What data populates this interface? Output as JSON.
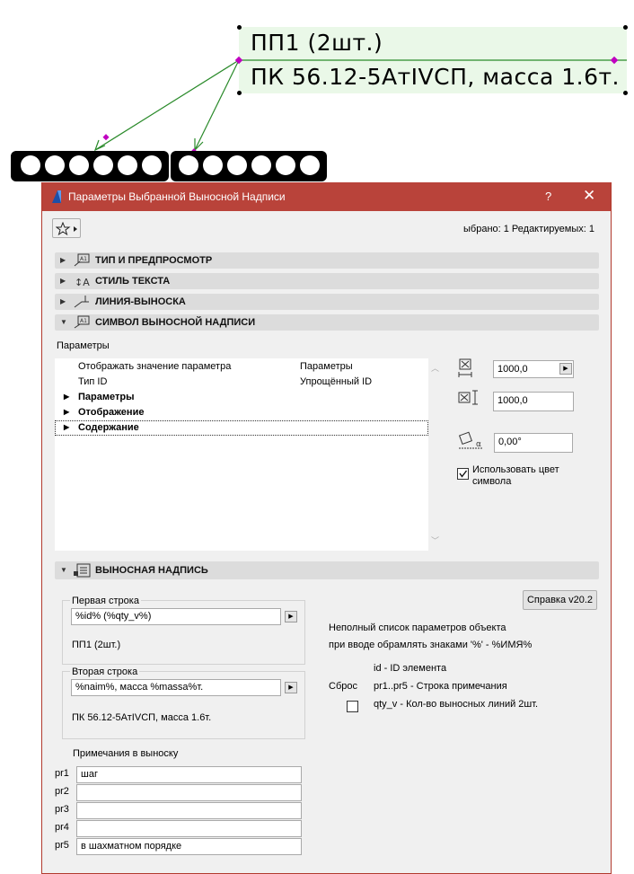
{
  "drawing": {
    "label_line1": "ПП1 (2шт.)",
    "label_line2": "ПК 56.12-5АтIVCП, масса 1.6т."
  },
  "dialog": {
    "title": "Параметры Выбранной Выносной Надписи",
    "help": "?",
    "close": "✕",
    "selected_info": "ыбрано: 1 Редактируемых: 1",
    "sections": {
      "type_preview": "ТИП И ПРЕДПРОСМОТР",
      "text_style": "СТИЛЬ ТЕКСТА",
      "leader_line": "ЛИНИЯ-ВЫНОСКА",
      "label_symbol": "СИМВОЛ ВЫНОСНОЙ НАДПИСИ",
      "label": "ВЫНОСНАЯ НАДПИСЬ"
    },
    "params_label": "Параметры",
    "tree": [
      {
        "name": "Отображать значение параметра",
        "value": "Параметры"
      },
      {
        "name": "Тип ID",
        "value": "Упрощённый ID"
      },
      {
        "name": "Параметры",
        "value": ""
      },
      {
        "name": "Отображение",
        "value": ""
      },
      {
        "name": "Содержание",
        "value": ""
      }
    ],
    "width_value": "1000,0",
    "height_value": "1000,0",
    "angle_value": "0,00°",
    "use_symbol_color_line1": "Использовать цвет",
    "use_symbol_color_line2": "символа",
    "help_button": "Справка v20.2",
    "first_line": {
      "legend": "Первая строка",
      "value": "%id% (%qty_v%)",
      "preview": "ПП1 (2шт.)"
    },
    "second_line": {
      "legend": "Вторая строка",
      "value": "%naim%, масса %massa%т.",
      "preview": "ПК 56.12-5АтIVCП, масса 1.6т."
    },
    "info": {
      "line1": "Неполный список параметров объекта",
      "line2": "при вводе обрамлять знаками '%' - %ИМЯ%",
      "line3": "id - ID элемента",
      "reset": "Сброс",
      "line4": "pr1..pr5 - Строка примечания",
      "line5": "qty_v - Кол-во выносных линий 2шт."
    },
    "notes": {
      "title": "Примечания в выноску",
      "rows": [
        {
          "label": "pr1",
          "value": "шаг"
        },
        {
          "label": "pr2",
          "value": ""
        },
        {
          "label": "pr3",
          "value": ""
        },
        {
          "label": "pr4",
          "value": ""
        },
        {
          "label": "pr5",
          "value": "в шахматном порядке"
        }
      ]
    }
  }
}
